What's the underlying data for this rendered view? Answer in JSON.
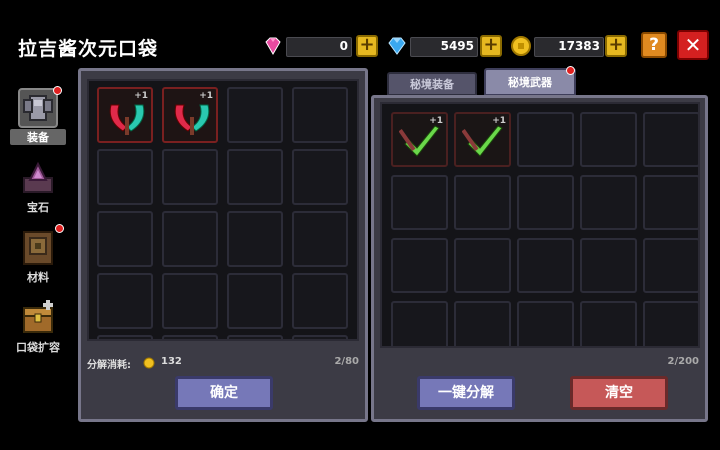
{
  "header": {
    "title": "拉吉酱次元口袋",
    "gems": "0",
    "diamonds": "5495",
    "coins": "17383",
    "help_label": "?",
    "close_label": "✕"
  },
  "nav": [
    {
      "label": "装备",
      "icon": "armor-icon",
      "active": true,
      "badge": true
    },
    {
      "label": "宝石",
      "icon": "gem-icon",
      "active": false,
      "badge": false
    },
    {
      "label": "材料",
      "icon": "material-book-icon",
      "active": false,
      "badge": true
    },
    {
      "label": "口袋扩容",
      "icon": "chest-icon",
      "active": false,
      "badge": false
    }
  ],
  "left_panel": {
    "decompose_label": "分解消耗:",
    "decompose_cost": "132",
    "capacity": "2/80",
    "confirm_label": "确定",
    "items": [
      {
        "name": "red-scythe",
        "level": "+1"
      },
      {
        "name": "red-scythe",
        "level": "+1"
      }
    ]
  },
  "right_panel": {
    "tabs": [
      "秘境装备",
      "秘境武器"
    ],
    "active_tab": 1,
    "capacity": "2/200",
    "decompose_all_label": "一键分解",
    "clear_label": "清空",
    "items": [
      {
        "name": "green-scythe",
        "level": "+1"
      },
      {
        "name": "green-scythe",
        "level": "+1"
      }
    ]
  },
  "colors": {
    "panel_bg": "#3c3b45",
    "confirm_button": "#7678b8",
    "clear_button": "#c65858"
  }
}
